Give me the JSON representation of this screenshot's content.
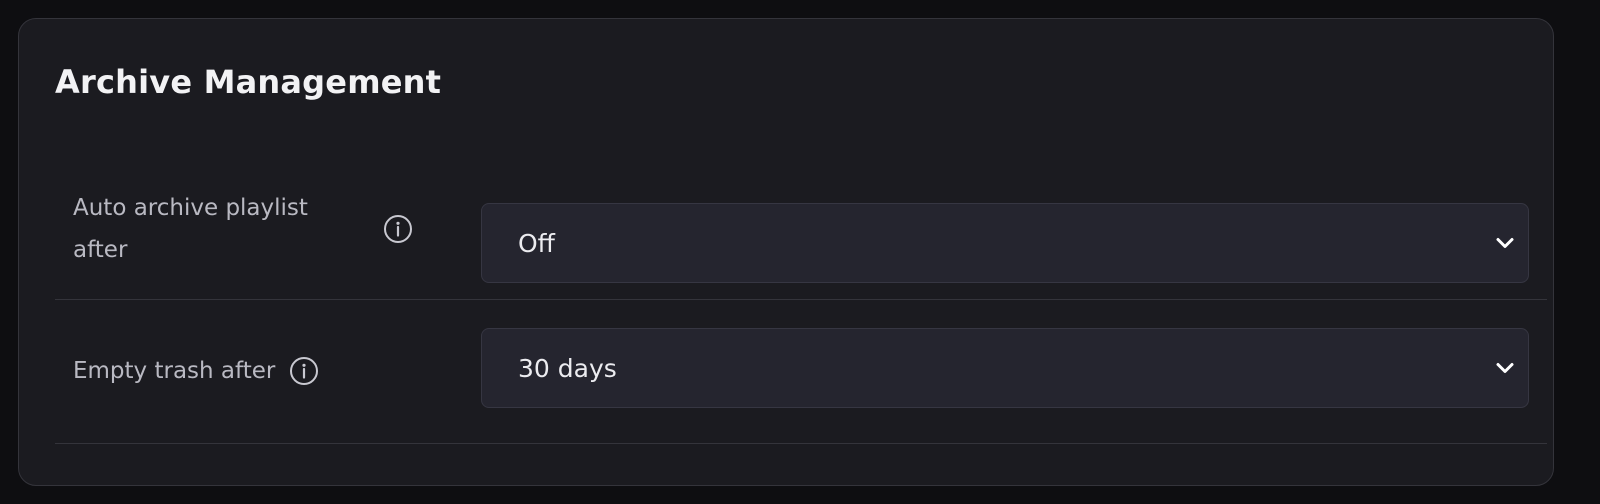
{
  "panel": {
    "title": "Archive Management"
  },
  "settings": [
    {
      "label": "Auto archive playlist after",
      "selected": "Off"
    },
    {
      "label": "Empty trash after",
      "selected": "30 days"
    }
  ],
  "icons": {
    "info": "info-circle-icon",
    "dropdown": "chevron-down-icon"
  },
  "colors": {
    "background": "#0e0e11",
    "panel": "#1b1b20",
    "select": "#25252f",
    "text": "#ececf0",
    "label": "#b9b9c2"
  }
}
